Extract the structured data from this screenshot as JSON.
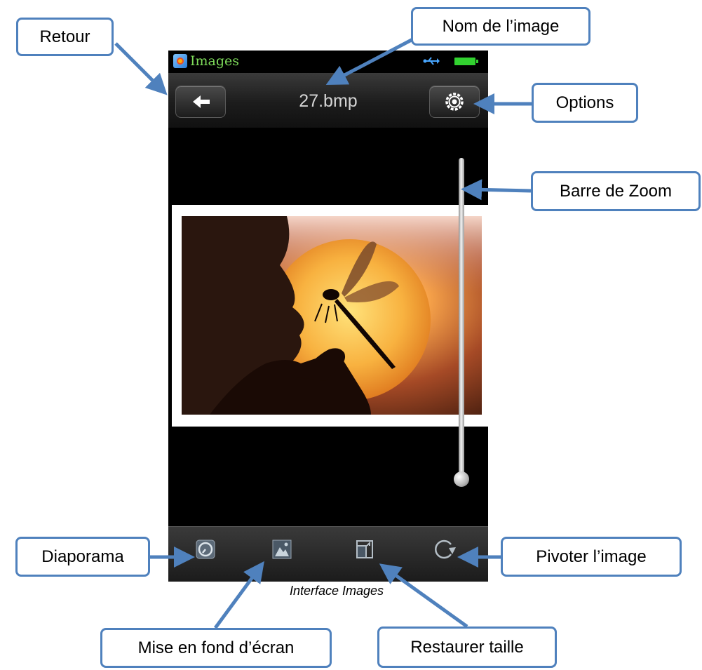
{
  "status_bar": {
    "app_name": "Images",
    "app_icon": "images-app-icon",
    "usb_icon": "usb-icon",
    "battery_icon": "battery-icon"
  },
  "header": {
    "back_icon": "left-arrow-icon",
    "title": "27.bmp",
    "options_icon": "gear-icon"
  },
  "viewer": {
    "image_name": "27.bmp",
    "zoom_level": 0.0
  },
  "toolbar": {
    "items": [
      {
        "icon": "slideshow-icon"
      },
      {
        "icon": "wallpaper-icon"
      },
      {
        "icon": "restore-size-icon"
      },
      {
        "icon": "rotate-icon"
      }
    ]
  },
  "callouts": {
    "retour": "Retour",
    "nom_image": "Nom de l’image",
    "options": "Options",
    "barre_zoom": "Barre de Zoom",
    "diaporama": "Diaporama",
    "pivoter": "Pivoter l’image",
    "mise_en_fond": "Mise en fond d’écran",
    "restaurer": "Restaurer taille"
  },
  "caption": "Interface Images",
  "colors": {
    "callout_border": "#4f81bd",
    "app_name": "#7edc5a",
    "battery": "#32d230",
    "usb": "#48a6ff"
  }
}
